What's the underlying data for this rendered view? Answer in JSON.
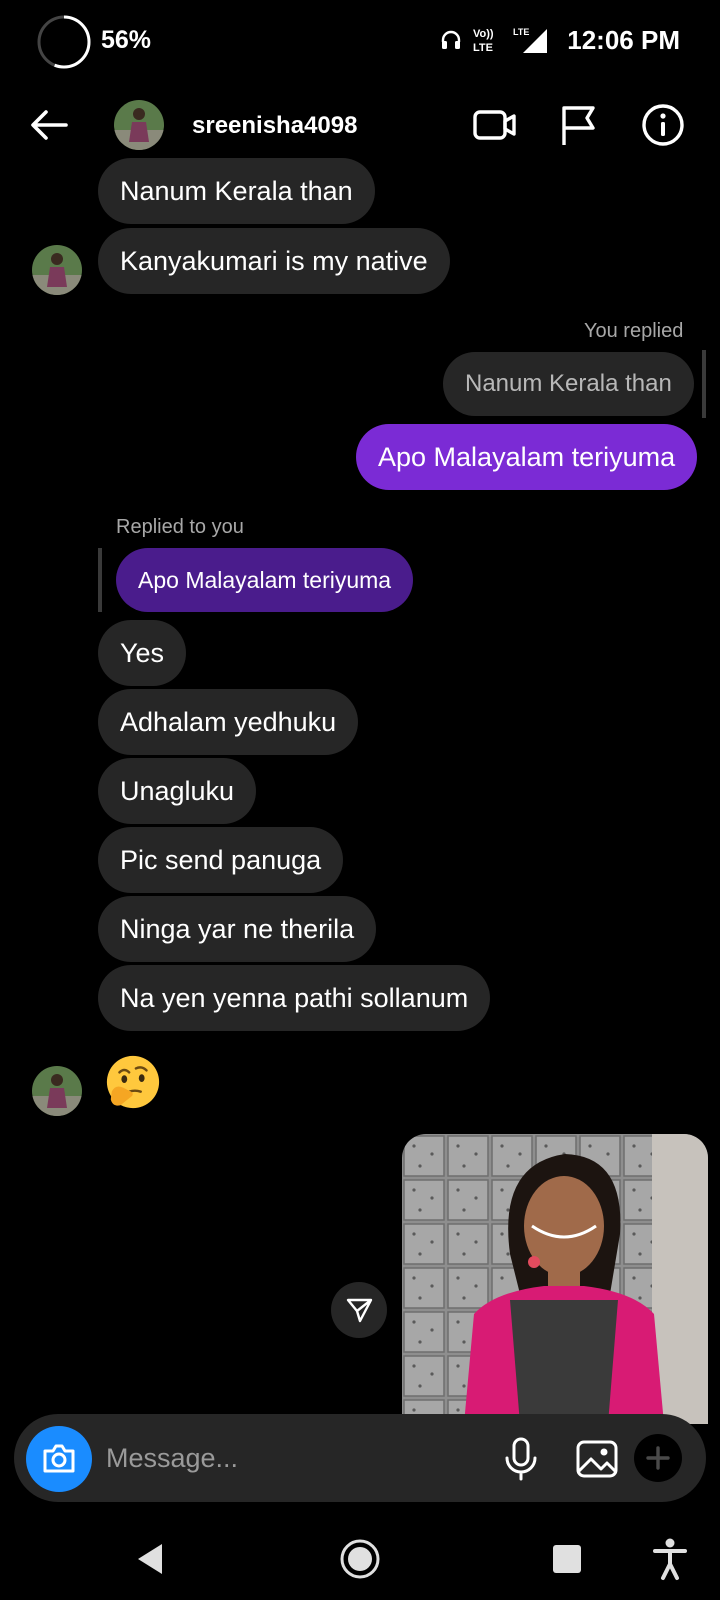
{
  "status_bar": {
    "battery_percent_label": "56%",
    "battery_level": 0.56,
    "network_label_top": "Vo))",
    "network_label_bottom": "LTE",
    "signal_label": "LTE",
    "time": "12:06 PM"
  },
  "header": {
    "username": "sreenisha4098",
    "icons": [
      "back-arrow-icon",
      "video-call-icon",
      "flag-icon",
      "info-icon"
    ]
  },
  "messages": [
    {
      "text": "Nanum Kerala than",
      "direction": "received"
    },
    {
      "text": "Kanyakumari is my native",
      "direction": "received"
    },
    {
      "label": "You replied",
      "quote": "Nanum Kerala than",
      "text": "Apo Malayalam teriyuma",
      "direction": "sent"
    },
    {
      "label": "Replied to you",
      "quote": "Apo Malayalam teriyuma"
    },
    {
      "text": "Yes",
      "direction": "received"
    },
    {
      "text": "Adhalam yedhuku",
      "direction": "received"
    },
    {
      "text": "Unagluku",
      "direction": "received"
    },
    {
      "text": "Pic send panuga",
      "direction": "received"
    },
    {
      "text": "Ninga yar ne therila",
      "direction": "received"
    },
    {
      "text": "Na yen yenna pathi sollanum",
      "direction": "received"
    },
    {
      "emoji": "thinking-face",
      "direction": "received"
    },
    {
      "attachment": "photo",
      "direction": "sent"
    }
  ],
  "composer": {
    "placeholder": "Message...",
    "icons": [
      "camera-icon",
      "microphone-icon",
      "gallery-icon",
      "plus-icon"
    ]
  },
  "colors": {
    "sent_bubble": "#7b2bd5",
    "received_bubble": "#262626",
    "quoted_purple": "#4a1c8c",
    "camera_button": "#1a8cff",
    "background": "#000000"
  }
}
